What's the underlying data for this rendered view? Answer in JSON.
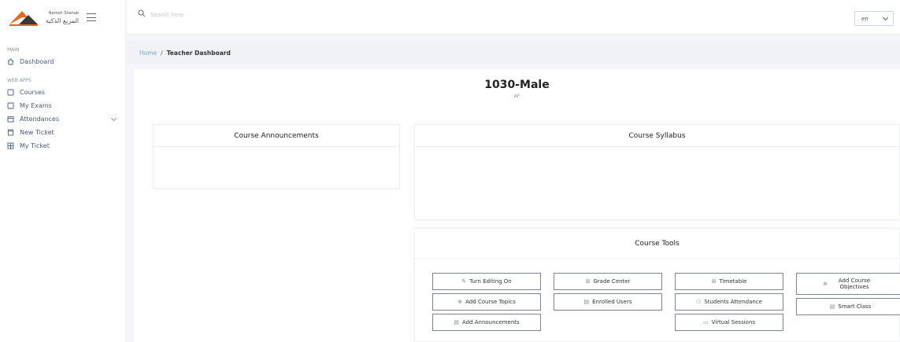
{
  "brand": {
    "name_en": "Nameh Shahab",
    "name_ar": "المربع الذكية",
    "accent_orange": "#e8661e",
    "accent_dark": "#3a3a3a"
  },
  "sidebar": {
    "section_main": "MAIN",
    "dashboard": {
      "label": "Dashboard",
      "icon": "home-icon"
    },
    "section_apps": "WEB APPS",
    "items": [
      {
        "label": "Courses",
        "icon": "square-icon"
      },
      {
        "label": "My Exams",
        "icon": "square-icon"
      },
      {
        "label": "Attendances",
        "icon": "calendar-icon",
        "expandable": true
      },
      {
        "label": "New Ticket",
        "icon": "ticket-icon"
      },
      {
        "label": "My Ticket",
        "icon": "grid-icon"
      }
    ]
  },
  "topbar": {
    "search_placeholder": "Search here",
    "language": "en"
  },
  "breadcrumb": {
    "home": "Home",
    "separator": "/",
    "current": "Teacher Dashboard"
  },
  "course": {
    "title": "1030-Male",
    "subtitle": "AF"
  },
  "cards": {
    "announcements": "Course Announcements",
    "syllabus": "Course Syllabus",
    "tools": "Course Tools"
  },
  "tools": [
    {
      "label": "Turn Editing On",
      "icon": "edit-icon"
    },
    {
      "label": "Add Course Topics",
      "icon": "plus-icon"
    },
    {
      "label": "Add Announcements",
      "icon": "calendar-icon"
    },
    {
      "label": "Grade Center",
      "icon": "grid-icon"
    },
    {
      "label": "Enrolled Users",
      "icon": "calendar-icon"
    },
    {
      "label": "Timetable",
      "icon": "grid-icon"
    },
    {
      "label": "Students Attendance",
      "icon": "user-icon"
    },
    {
      "label": "Virtual Sessions",
      "icon": "video-icon"
    },
    {
      "label": "Add Course Objectives",
      "icon": "plus-icon"
    },
    {
      "label": "Smart Class",
      "icon": "calendar-icon"
    }
  ]
}
